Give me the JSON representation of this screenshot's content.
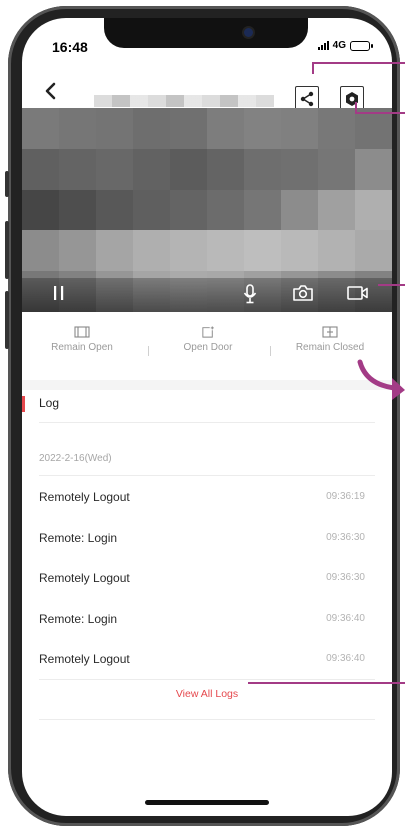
{
  "status_bar": {
    "time": "16:48",
    "network": "4G"
  },
  "nav": {
    "back_icon": "chevron-left-icon",
    "share_icon": "share-icon",
    "settings_icon": "settings-hexagon-icon"
  },
  "video": {
    "controls": [
      "pause-icon",
      "microphone-icon",
      "camera-icon",
      "video-record-icon"
    ]
  },
  "actions": [
    {
      "label": "Remain Open",
      "icon": "remain-open-icon"
    },
    {
      "label": "Open Door",
      "icon": "open-door-icon"
    },
    {
      "label": "Remain Closed",
      "icon": "remain-closed-icon"
    }
  ],
  "log": {
    "title": "Log",
    "date": "2022-2-16(Wed)",
    "entries": [
      {
        "event": "Remotely Logout",
        "time": "09:36:19"
      },
      {
        "event": "Remote: Login",
        "time": "09:36:30"
      },
      {
        "event": "Remotely Logout",
        "time": "09:36:30"
      },
      {
        "event": "Remote: Login",
        "time": "09:36:40"
      },
      {
        "event": "Remotely Logout",
        "time": "09:36:40"
      }
    ],
    "view_all": "View All Logs"
  },
  "colors": {
    "accent_red": "#e5484d",
    "annotation_purple": "#a33b86"
  }
}
